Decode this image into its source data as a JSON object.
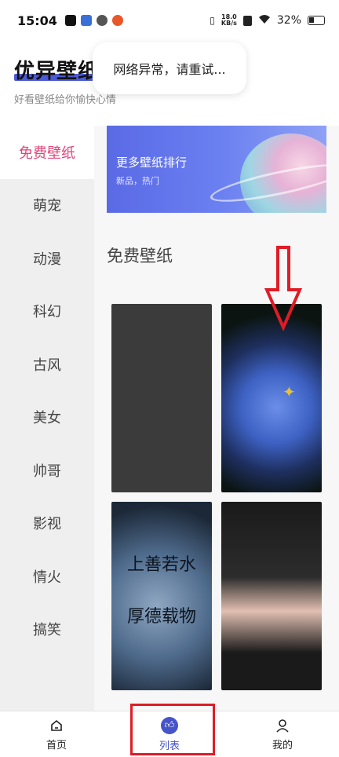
{
  "status": {
    "time": "15:04",
    "net_speed_value": "18.0",
    "net_speed_unit": "KB/s",
    "battery": "32%"
  },
  "header": {
    "title": "优异壁纸",
    "subtitle": "好看壁纸给你愉快心情"
  },
  "toast": {
    "text": "网络异常，请重试..."
  },
  "sidebar": {
    "items": [
      {
        "label": "免费壁纸",
        "active": true
      },
      {
        "label": "萌宠"
      },
      {
        "label": "动漫"
      },
      {
        "label": "科幻"
      },
      {
        "label": "古风"
      },
      {
        "label": "美女"
      },
      {
        "label": "帅哥"
      },
      {
        "label": "影视"
      },
      {
        "label": "情火"
      },
      {
        "label": "搞笑"
      }
    ]
  },
  "banner": {
    "title": "更多壁纸排行",
    "subtitle": "新品，热门"
  },
  "section": {
    "title": "免费壁纸"
  },
  "wallpapers": {
    "calligraphy_line1": "上善若水",
    "calligraphy_line2": "厚德载物"
  },
  "bottom_nav": {
    "items": [
      {
        "label": "首页",
        "icon": "home-icon"
      },
      {
        "label": "列表",
        "icon": "thumbs-up-icon",
        "active": true
      },
      {
        "label": "我的",
        "icon": "user-icon"
      }
    ]
  },
  "colors": {
    "accent": "#4554c9",
    "active_category": "#e0457b",
    "annotation": "#e01c26"
  }
}
